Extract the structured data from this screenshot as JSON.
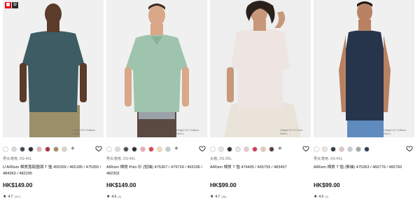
{
  "brand": {
    "logo_text": "UNIQLO",
    "logo_mark_u": "U"
  },
  "products": [
    {
      "model_note": "Height 6'1\"/186cm Size:L",
      "swatches": [
        "#ffffff",
        "#dcd8d0",
        "#3b4754",
        "#2b2f36",
        "#e0b3b8",
        "#b22a3f",
        "#a38a5b",
        "#d8d4c4"
      ],
      "has_more": true,
      "more_label": "+",
      "category": "男女適用, XS-4XL",
      "name": "U AIRism 棉質寬鬆圓領 T 恤 455359 / 465185 / 475355 / 484363 / 482295",
      "price": "HK$149.00",
      "rating": "4.7",
      "review_count": "(307)",
      "colors": {
        "shirt": "#3d5c63",
        "pants": "#9b9069",
        "skin": "#5b3b29",
        "bg": "#f0f0f0"
      }
    },
    {
      "model_note": "Height 6'1\"/186cm Size:L",
      "swatches": [
        "#ffffff",
        "#d9d9d9",
        "#4c4c4c",
        "#2b2f36",
        "#f0a6b4",
        "#e04050",
        "#f2dcb0",
        "#b9d0c8"
      ],
      "has_more": true,
      "more_label": "+",
      "category": "男女適用, XS-4XL",
      "name": "AIRism 棉質 Polo 衫 (短袖) 475367 / 479724 / 465196 / 482302",
      "price": "HK$149.00",
      "rating": "4.6",
      "review_count": "(5)",
      "colors": {
        "shirt": "#9fc4ad",
        "pants": "#5a4a42",
        "skin": "#d8a888",
        "bg": "#f0f0f0"
      }
    },
    {
      "model_note": "Height 5'7\"/172cm Size:L",
      "swatches": [
        "#ffffff",
        "#e6e6e6",
        "#333333",
        "#ece6e8",
        "#f0c5d2",
        "#d63b5a",
        "#e8c9a8",
        "#5a3e36"
      ],
      "has_more": true,
      "more_label": "+",
      "category": "女裝, XS-3XL",
      "name": "AIRism 棉質 T 恤 474405 / 465755 / 483457",
      "price": "HK$99.00",
      "rating": "4.7",
      "review_count": "(86)",
      "colors": {
        "shirt": "#eee5e3",
        "pants": "#e9e3da",
        "skin": "#c99779",
        "bg": "#eeeeee"
      }
    },
    {
      "model_note": "Height 6'1\"/186cm Size:L",
      "swatches": [
        "#ffffff",
        "#e6e6e6",
        "#2f3a44",
        "#e5c0c8",
        "#c5cdd6",
        "#9aa8a4",
        "#2d3d55"
      ],
      "has_more": false,
      "more_label": "",
      "category": "男女適用, XS-4XL",
      "name": "AIRism 棉質 T 恤 (無袖) 475363 / 466776 / 482760",
      "price": "HK$99.00",
      "rating": "4.5",
      "review_count": "(2)",
      "colors": {
        "shirt": "#26344c",
        "pants": "#5f8bbf",
        "skin": "#b88262",
        "bg": "#f0f0f0"
      }
    }
  ]
}
